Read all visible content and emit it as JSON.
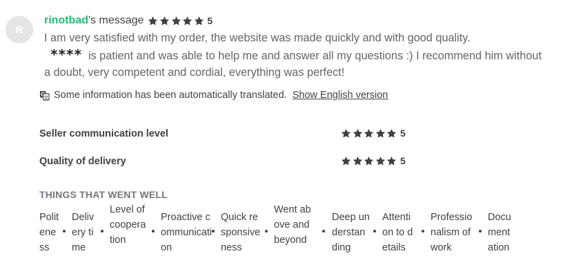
{
  "reviewer": {
    "avatar_letter": "R",
    "username": "rinotbad",
    "suffix": "'s message",
    "rating": "5",
    "stars": 5
  },
  "review": {
    "text_before": "I am very satisfied with my order, the website was made quickly and with good quality.",
    "masked_name": "****",
    "text_after": " is patient and was able to help me and answer all my questions :) I recommend him without a doubt, very competent and cordial, everything was perfect!"
  },
  "translation": {
    "notice": "Some information has been automatically translated.",
    "link": "Show English version"
  },
  "sub_ratings": [
    {
      "label": "Seller communication level",
      "value": "5",
      "stars": 5
    },
    {
      "label": "Quality of delivery",
      "value": "5",
      "stars": 5
    }
  ],
  "things_title": "THINGS THAT WENT WELL",
  "things": [
    "Politeness",
    "Delivery time",
    "Level of cooperation",
    "Proactive communication",
    "Quick responsiveness",
    "Went above and beyond",
    "Deep understanding",
    "Attention to details",
    "Professionalism of work",
    "Documentation"
  ],
  "colors": {
    "brand_green": "#1dbf73",
    "text": "#404145",
    "muted": "#62646a",
    "avatar_bg": "#e4e5e7"
  }
}
